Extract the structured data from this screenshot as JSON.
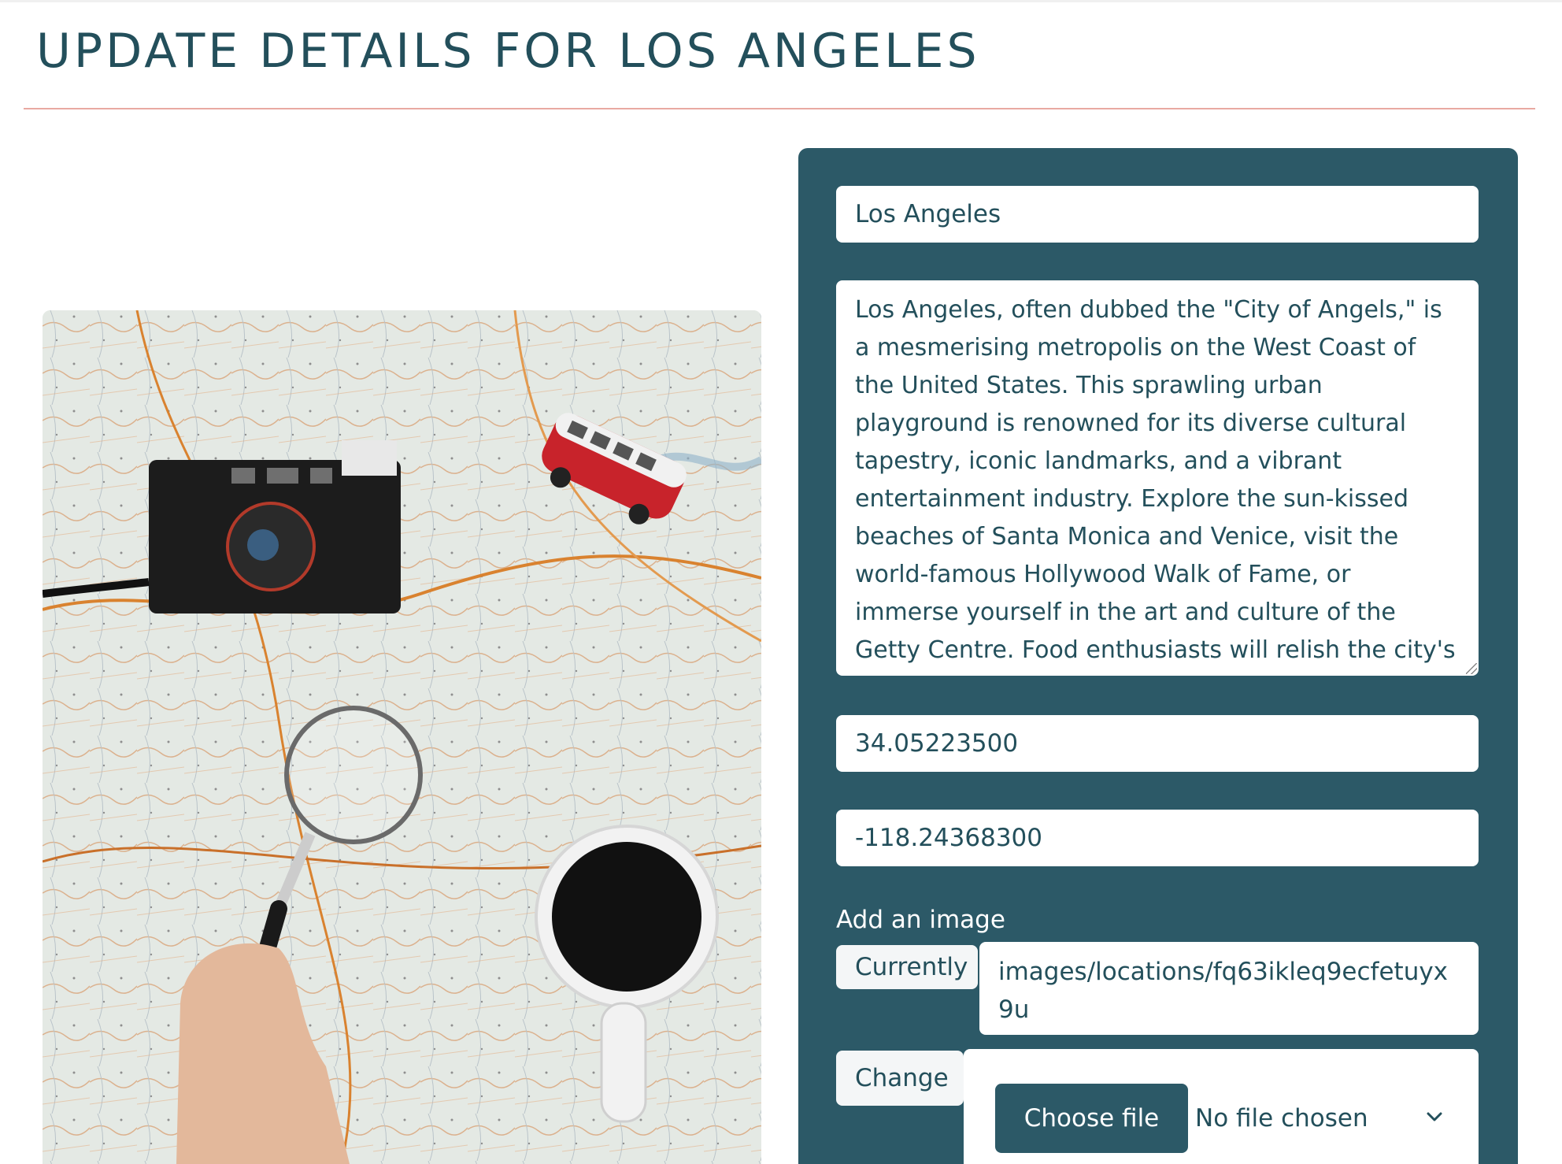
{
  "page": {
    "title": "UPDATE DETAILS FOR LOS ANGELES"
  },
  "form": {
    "name_value": "Los Angeles",
    "description_value": "Los Angeles, often dubbed the \"City of Angels,\" is a mesmerising metropolis on the West Coast of the United States. This sprawling urban playground is renowned for its diverse cultural tapestry, iconic landmarks, and a vibrant entertainment industry. Explore the sun-kissed beaches of Santa Monica and Venice, visit the world-famous Hollywood Walk of Fame, or immerse yourself in the art and culture of the Getty Centre. Food enthusiasts will relish the city's culinary delights, from gourmet food trucks to",
    "latitude_value": "34.05223500",
    "longitude_value": "-118.24368300",
    "image_label": "Add an image",
    "currently_label": "Currently",
    "current_image_path": "images/locations/fq63ikleq9ecfetuyx9u",
    "change_label": "Change",
    "choose_file_label": "Choose file",
    "no_file_text": "No file chosen"
  },
  "icons": {
    "dropdown": "chevron-down-icon"
  },
  "colors": {
    "panel": "#2c5967",
    "title": "#234f5b",
    "divider": "#e9a9a2"
  }
}
